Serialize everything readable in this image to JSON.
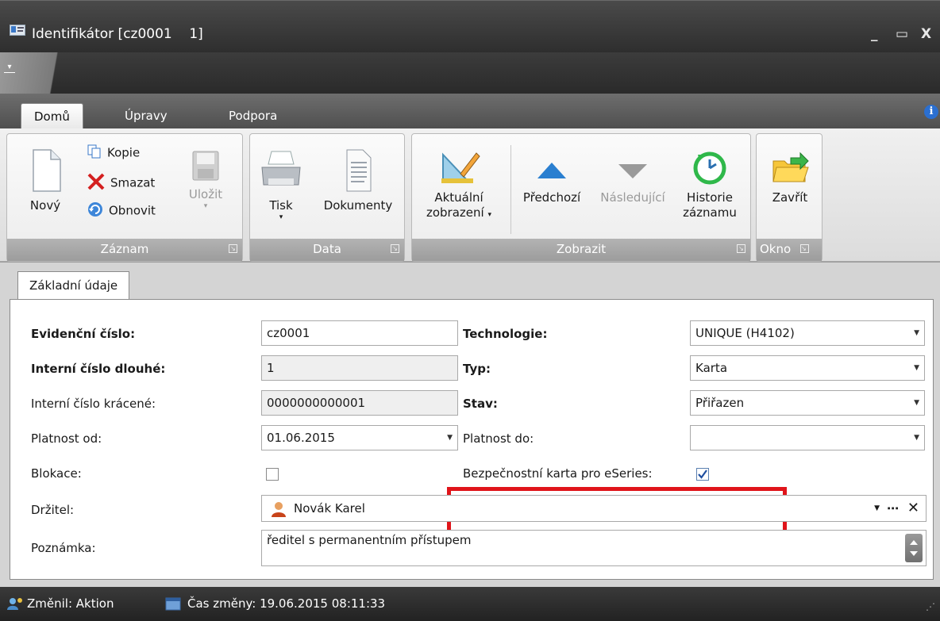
{
  "window": {
    "title": "Identifikátor [cz0001    1]",
    "minimize": "_",
    "maximize": "▭",
    "close": "X"
  },
  "ribbon_tabs": [
    "Domů",
    "Úpravy",
    "Podpora"
  ],
  "ribbon": {
    "zaznam": {
      "label": "Záznam",
      "new": "Nový",
      "copy": "Kopie",
      "delete": "Smazat",
      "refresh": "Obnovit",
      "save": "Uložit"
    },
    "data": {
      "label": "Data",
      "print": "Tisk",
      "documents": "Dokumenty"
    },
    "zobrazit": {
      "label": "Zobrazit",
      "current_view_line1": "Aktuální",
      "current_view_line2": "zobrazení",
      "previous": "Předchozí",
      "next": "Následující",
      "history_line1": "Historie",
      "history_line2": "záznamu"
    },
    "okno": {
      "label": "Okno",
      "close": "Zavřít"
    }
  },
  "content_tab": "Základní údaje",
  "form": {
    "evidencni_cislo": {
      "label": "Evidenční číslo:",
      "value": "cz0001"
    },
    "interni_dlouhe": {
      "label": "Interní číslo dlouhé:",
      "value": "1"
    },
    "interni_kracene": {
      "label": "Interní číslo krácené:",
      "value": "0000000000001"
    },
    "platnost_od": {
      "label": "Platnost od:",
      "value": "01.06.2015"
    },
    "blokace": {
      "label": "Blokace:",
      "checked": false
    },
    "drzitel": {
      "label": "Držitel:",
      "value": "Novák Karel"
    },
    "poznamka": {
      "label": "Poznámka:",
      "value": "ředitel s permanentním přístupem"
    },
    "technologie": {
      "label": "Technologie:",
      "value": "UNIQUE (H4102)"
    },
    "typ": {
      "label": "Typ:",
      "value": "Karta"
    },
    "stav": {
      "label": "Stav:",
      "value": "Přiřazen"
    },
    "platnost_do": {
      "label": "Platnost do:",
      "value": ""
    },
    "bezpecnostni": {
      "label": "Bezpečnostní karta pro eSeries:",
      "checked": true
    }
  },
  "status": {
    "changed_by": "Změnil: Aktion",
    "changed_at": "Čas změny: 19.06.2015 08:11:33"
  },
  "colors": {
    "highlight": "#e0141a",
    "titlebar": "#2e2e2e"
  }
}
